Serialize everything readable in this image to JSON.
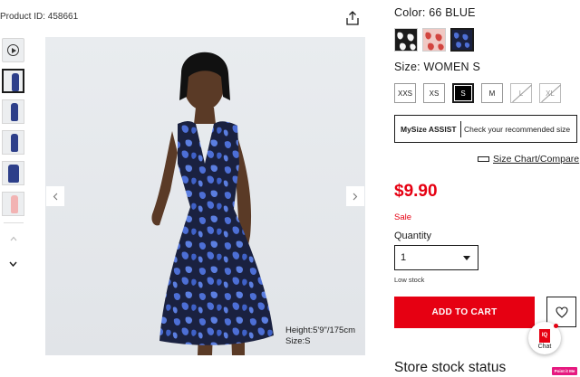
{
  "product": {
    "id_text": "Product ID: 458661",
    "price": "$9.90",
    "sale_label": "Sale"
  },
  "gallery": {
    "thumbnail_count": 6,
    "model_caption_height": "Height:5'9\"/175cm",
    "model_caption_size": "Size:S",
    "icons": [
      "play-icon",
      "chevron-left-icon",
      "chevron-right-icon",
      "chevron-up-icon",
      "chevron-down-icon",
      "share-icon"
    ]
  },
  "color": {
    "label_prefix": "Color:",
    "selected": "66 BLUE",
    "swatches": [
      {
        "name": "black-white-print",
        "base": "#1a1a1a",
        "accent": "#f5f5f5"
      },
      {
        "name": "pink-print",
        "base": "#f0c9c4",
        "accent": "#d2453f"
      },
      {
        "name": "blue-print",
        "base": "#1a2140",
        "accent": "#4d6fd6"
      }
    ]
  },
  "size": {
    "label_prefix": "Size:",
    "selected": "WOMEN S",
    "options": [
      {
        "label": "XXS",
        "state": "available"
      },
      {
        "label": "XS",
        "state": "available"
      },
      {
        "label": "S",
        "state": "selected"
      },
      {
        "label": "M",
        "state": "available"
      },
      {
        "label": "L",
        "state": "unavailable"
      },
      {
        "label": "XL",
        "state": "unavailable"
      }
    ]
  },
  "mysize": {
    "brand": "MySize ASSIST",
    "text": "Check your recommended size"
  },
  "size_chart": {
    "label": "Size Chart/Compare"
  },
  "quantity": {
    "label": "Quantity",
    "value": "1",
    "stock_note": "Low stock"
  },
  "actions": {
    "add_to_cart": "ADD TO CART"
  },
  "chat": {
    "logo_text": "IQ",
    "label": "Chat"
  },
  "store_stock": {
    "heading": "Store stock status"
  },
  "badge": {
    "text": "Point it Me"
  },
  "colors": {
    "brand_red": "#e60012",
    "text": "#1b1b1b",
    "dress_base": "#1a2140",
    "dress_print": "#4d6fd6"
  }
}
